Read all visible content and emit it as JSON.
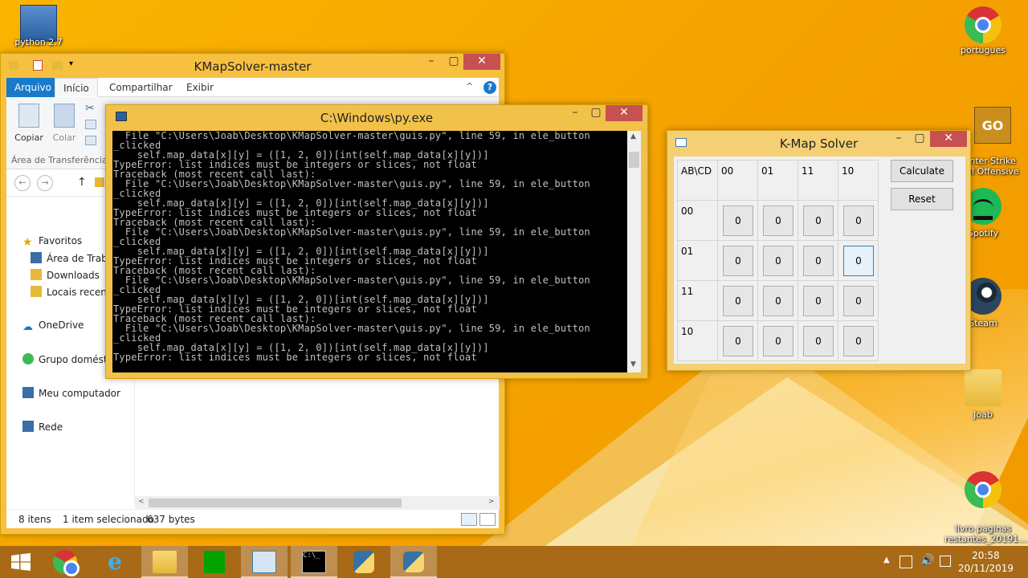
{
  "desktop": {
    "icons": [
      {
        "label": "python 2.7"
      },
      {
        "label": "portugues"
      },
      {
        "label": "nter-Strike\nal Offensive"
      },
      {
        "label": "Spotify"
      },
      {
        "label": "Steam"
      },
      {
        "label": "Joab"
      },
      {
        "label": "livro paginas\nrestantes_20191..."
      }
    ]
  },
  "explorer": {
    "title": "KMapSolver-master",
    "tabs": [
      "Arquivo",
      "Início",
      "Compartilhar",
      "Exibir"
    ],
    "ribbon": {
      "copy": "Copiar",
      "paste": "Colar",
      "group": "Área de Transferência"
    },
    "nav": {
      "favorites": "Favoritos",
      "desktop": "Área de Trabalho",
      "downloads": "Downloads",
      "recent": "Locais recentes",
      "onedrive": "OneDrive",
      "homegroup": "Grupo doméstico",
      "computer": "Meu computador",
      "network": "Rede"
    },
    "status": {
      "items": "8 itens",
      "selected": "1 item selecionado",
      "size": "637 bytes"
    }
  },
  "console": {
    "title": "C:\\Windows\\py.exe",
    "output": "  File \"C:\\Users\\Joab\\Desktop\\KMapSolver-master\\guis.py\", line 59, in ele_button\n_clicked\n    self.map_data[x][y] = ([1, 2, 0])[int(self.map_data[x][y])]\nTypeError: list indices must be integers or slices, not float\nTraceback (most recent call last):\n  File \"C:\\Users\\Joab\\Desktop\\KMapSolver-master\\guis.py\", line 59, in ele_button\n_clicked\n    self.map_data[x][y] = ([1, 2, 0])[int(self.map_data[x][y])]\nTypeError: list indices must be integers or slices, not float\nTraceback (most recent call last):\n  File \"C:\\Users\\Joab\\Desktop\\KMapSolver-master\\guis.py\", line 59, in ele_button\n_clicked\n    self.map_data[x][y] = ([1, 2, 0])[int(self.map_data[x][y])]\nTypeError: list indices must be integers or slices, not float\nTraceback (most recent call last):\n  File \"C:\\Users\\Joab\\Desktop\\KMapSolver-master\\guis.py\", line 59, in ele_button\n_clicked\n    self.map_data[x][y] = ([1, 2, 0])[int(self.map_data[x][y])]\nTypeError: list indices must be integers or slices, not float\nTraceback (most recent call last):\n  File \"C:\\Users\\Joab\\Desktop\\KMapSolver-master\\guis.py\", line 59, in ele_button\n_clicked\n    self.map_data[x][y] = ([1, 2, 0])[int(self.map_data[x][y])]\nTypeError: list indices must be integers or slices, not float"
  },
  "kmap": {
    "title": "K-Map Solver",
    "corner": "AB\\CD",
    "col_headers": [
      "00",
      "01",
      "11",
      "10"
    ],
    "row_headers": [
      "00",
      "01",
      "11",
      "10"
    ],
    "values": [
      [
        "0",
        "0",
        "0",
        "0"
      ],
      [
        "0",
        "0",
        "0",
        "0"
      ],
      [
        "0",
        "0",
        "0",
        "0"
      ],
      [
        "0",
        "0",
        "0",
        "0"
      ]
    ],
    "calculate_label": "Calculate",
    "reset_label": "Reset"
  },
  "taskbar": {
    "time": "20:58",
    "date": "20/11/2019"
  },
  "colors": {
    "taskbar": "#a86a16",
    "accent_blue": "#1979ca",
    "close_red": "#c75050"
  }
}
